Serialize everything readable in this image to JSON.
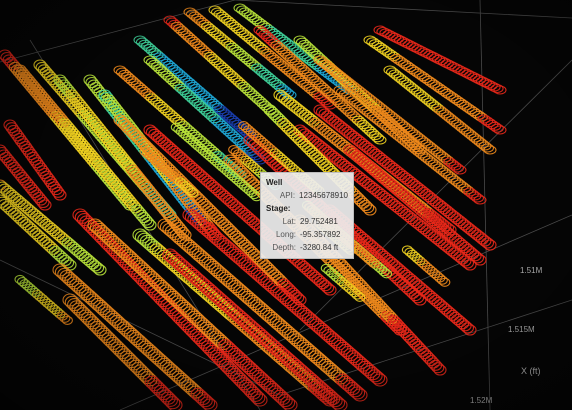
{
  "chart_data": {
    "type": "scatter",
    "title": "",
    "axis_x_label": "X (ft)",
    "tick_labels": [
      "1.51M",
      "1.515M",
      "1.52M"
    ],
    "colormap": [
      "#1a3fb0",
      "#1ea7d6",
      "#3fd29a",
      "#b8e23a",
      "#f0d020",
      "#f08a1c",
      "#e8281a"
    ],
    "grid": true,
    "tooltip": {
      "well_header": "Well",
      "api_label": "API:",
      "api_value": "12345678910",
      "stage_header": "Stage:",
      "lat_label": "Lat:",
      "lat_value": "29.752481",
      "long_label": "Long:",
      "long_value": "-95.357892",
      "depth_label": "Depth:",
      "depth_value": "-3280.84 ft"
    }
  }
}
